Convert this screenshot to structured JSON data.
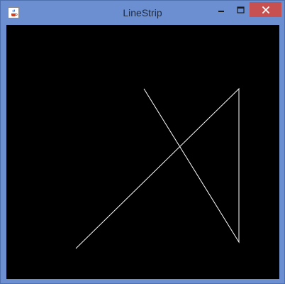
{
  "window": {
    "title": "LineStrip",
    "icon": "java-cup-icon",
    "controls": {
      "minimize_icon": "minimize-icon",
      "maximize_icon": "maximize-icon",
      "close_icon": "close-icon"
    },
    "colors": {
      "frame": "#6b8fd0",
      "close_button": "#c75050",
      "canvas_background": "#000000",
      "line": "#ffffff"
    }
  },
  "drawing": {
    "type": "line-strip",
    "point_count": 4
  }
}
